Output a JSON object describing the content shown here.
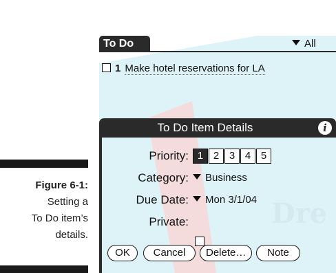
{
  "caption": {
    "figure_label": "Figure 6-1:",
    "line1": "Setting a",
    "line2": "To Do item’s",
    "line3": "details."
  },
  "app": {
    "title": "To Do",
    "category_filter": "All"
  },
  "todo_items": [
    {
      "priority": "1",
      "text": "Make hotel reservations for LA"
    }
  ],
  "dialog": {
    "title": "To Do Item Details",
    "priority_label": "Priority:",
    "priority_options": [
      "1",
      "2",
      "3",
      "4",
      "5"
    ],
    "priority_selected": "1",
    "category_label": "Category:",
    "category_value": "Business",
    "due_date_label": "Due Date:",
    "due_date_value": "Mon 3/1/04",
    "private_label": "Private:",
    "private_checked": false,
    "buttons": {
      "ok": "OK",
      "cancel": "Cancel",
      "delete": "Delete…",
      "note": "Note"
    }
  },
  "watermark_text": "Dre",
  "colors": {
    "header": "#2a2a2a",
    "watermark_blue": "#d8f0f6",
    "watermark_red": "#f4d6d6"
  }
}
